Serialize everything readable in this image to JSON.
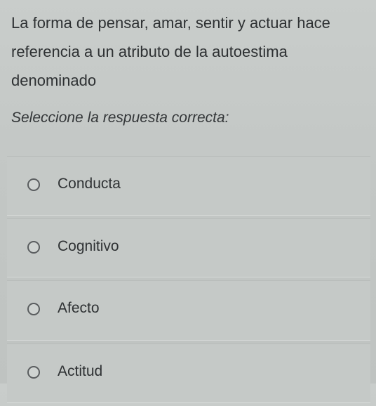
{
  "question": {
    "text": "La forma de pensar, amar, sentir y actuar hace referencia a un atributo de la autoestima denominado"
  },
  "instruction": "Seleccione la respuesta correcta:",
  "options": [
    {
      "label": "Conducta"
    },
    {
      "label": "Cognitivo"
    },
    {
      "label": "Afecto"
    },
    {
      "label": "Actitud"
    }
  ]
}
